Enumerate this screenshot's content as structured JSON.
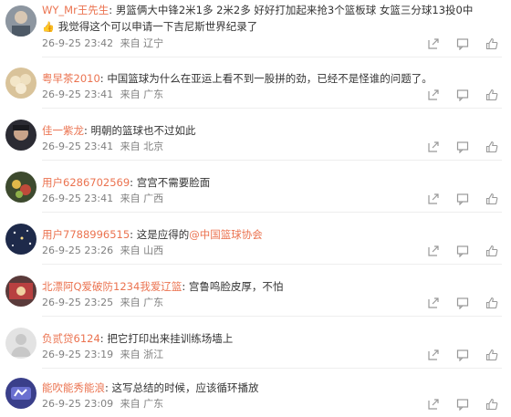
{
  "comments": [
    {
      "user": "WY_Mr王先生",
      "text": "男篮俩大中锋2米1多   2米2多   好好打加起来抢3个篮板球   女篮三分球13投0中",
      "text2": "我觉得这个可以申请一下吉尼斯世界纪录了",
      "time": "26-9-25 23:42",
      "source": "来自 辽宁"
    },
    {
      "user": "粤早茶2010",
      "text": "中国篮球为什么在亚运上看不到一股拼的劲，已经不是怪谁的问题了。",
      "time": "26-9-25 23:41",
      "source": "来自 广东"
    },
    {
      "user": "佳一紫龙",
      "text": "明朝的篮球也不过如此",
      "time": "26-9-25 23:41",
      "source": "来自 北京"
    },
    {
      "user": "用户6286702569",
      "text": "宫宫不需要脸面",
      "time": "26-9-25 23:41",
      "source": "来自 广西"
    },
    {
      "user": "用户7788996515",
      "text": "这是应得的",
      "mention": "@中国篮球协会",
      "time": "26-9-25 23:26",
      "source": "来自 山西"
    },
    {
      "user": "北漂阿Q爱破防1234我爱辽篮",
      "text": "宫鲁鸣脸皮厚，不怕",
      "time": "26-9-25 23:25",
      "source": "来自 广东"
    },
    {
      "user": "负贰贷6124",
      "text": "把它打印出来挂训练场墙上",
      "time": "26-9-25 23:19",
      "source": "来自 浙江"
    },
    {
      "user": "能吹能秀能浪",
      "text": "这写总结的时候，应该循环播放",
      "time": "26-9-25 23:09",
      "source": "来自 广东"
    }
  ],
  "icons": {
    "share": "share-icon",
    "comment": "comment-icon",
    "like": "like-icon"
  },
  "colors": {
    "username": "#eb7350",
    "meta": "#808080"
  }
}
